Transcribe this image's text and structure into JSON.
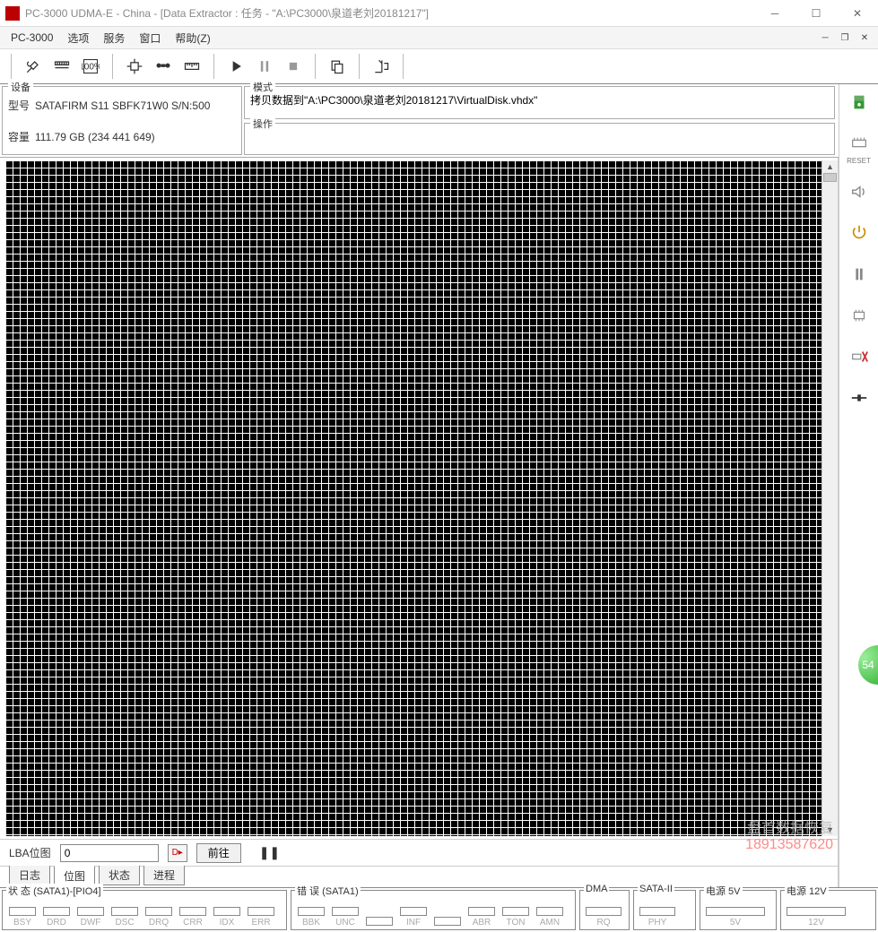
{
  "title": "PC-3000 UDMA-E - China - [Data Extractor : 任务 - \"A:\\PC3000\\泉道老刘20181217\"]",
  "menubar": {
    "app": "PC-3000",
    "items": [
      "选项",
      "服务",
      "窗口",
      "帮助(Z)"
    ]
  },
  "info": {
    "device_legend": "设备",
    "model_label": "型号",
    "model_value": "SATAFIRM   S11 SBFK71W0 S/N:500",
    "capacity_label": "容量",
    "capacity_value": "111.79 GB (234 441 649)",
    "mode_legend": "模式",
    "mode_value": "拷贝数据到\"A:\\PC3000\\泉道老刘20181217\\VirtualDisk.vhdx\"",
    "op_legend": "操作"
  },
  "bitmap_footer": {
    "lba_label": "LBA位图",
    "lba_value": "0",
    "goto": "前往"
  },
  "tabs": [
    "日志",
    "位图",
    "状态",
    "进程"
  ],
  "active_tab_index": 1,
  "right_labels": {
    "reset": "RESET"
  },
  "status": {
    "g1_legend": "状 态 (SATA1)-[PIO4]",
    "g1": [
      "BSY",
      "DRD",
      "DWF",
      "DSC",
      "DRQ",
      "CRR",
      "IDX",
      "ERR"
    ],
    "g2_legend": "错 误 (SATA1)",
    "g2": [
      "BBK",
      "UNC",
      "",
      "INF",
      "",
      "ABR",
      "TON",
      "AMN"
    ],
    "g3_legend": "DMA",
    "g3": [
      "RQ"
    ],
    "g4_legend": "SATA-II",
    "g4": [
      "PHY"
    ],
    "g5_legend": "电源 5V",
    "g5": [
      "5V"
    ],
    "g6_legend": "电源 12V",
    "g6": [
      "12V"
    ]
  },
  "watermark": {
    "line1": "盘首数据恢复",
    "line2": "18913587620"
  },
  "knob": "54"
}
